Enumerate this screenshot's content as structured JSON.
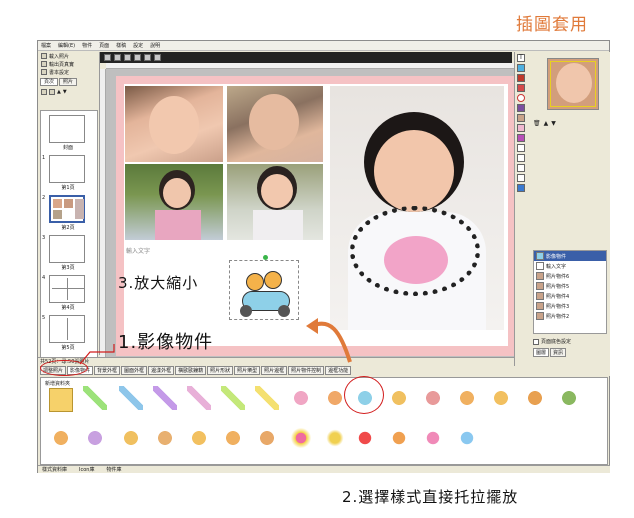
{
  "heading": "插圖套用",
  "menu": [
    "檔案",
    "編輯(E)",
    "物件",
    "頁面",
    "樣稿",
    "設定",
    "說明"
  ],
  "left_panel": {
    "items": [
      "載入照片",
      "輸出頁真實",
      "書本設定"
    ],
    "tabs": [
      "頁次",
      "照片"
    ],
    "pages": [
      "封面",
      "第1頁",
      "第2頁",
      "第3頁",
      "第4頁",
      "第5頁"
    ],
    "numbers": [
      "1",
      "2",
      "3",
      "4",
      "5"
    ]
  },
  "canvas": {
    "text_placeholder": "輸入文字"
  },
  "status": {
    "text": "共52頁：尋:50張照片"
  },
  "right_panel": {
    "layers": [
      "影像物件",
      "輸入文字",
      "照片物件6",
      "照片物件5",
      "照片物件4",
      "照片物件3",
      "照片物件2"
    ],
    "checkbox_label": "頁面底色設定",
    "tabs": [
      "圖層",
      "資訊"
    ]
  },
  "bottom_tabs": [
    "調整照片",
    "影像物件",
    "背景外框",
    "圖面外框",
    "邊漾外框",
    "橫歐歐鐘籍",
    "照片形狀",
    "照片樂型",
    "照片邊框",
    "照片物件控制",
    "邊框功能"
  ],
  "library": {
    "folder_label": "新增資料夾"
  },
  "bottom_bar": [
    "樣式資料庫",
    "Icon庫",
    "物件庫"
  ],
  "annotations": {
    "step1": "1.影像物件",
    "step2": "2.選擇樣式直接托拉擺放",
    "step3": "3.放大縮小"
  },
  "colors": {
    "accent": "#e07a3a",
    "page_border": "#f5c2c4",
    "ring": "#d21c1c"
  }
}
